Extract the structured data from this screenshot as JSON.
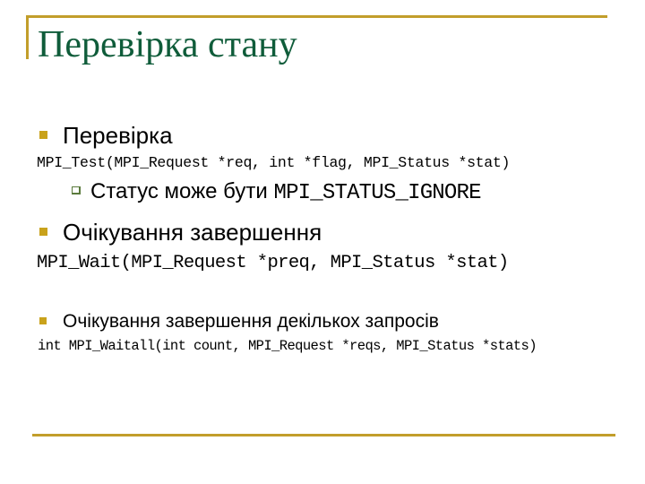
{
  "slide": {
    "title": "Перевірка стану",
    "accent_color": "#c29e2b",
    "title_color": "#0f5c3a",
    "items": [
      {
        "bullet": "filled-square",
        "text": "Перевірка",
        "code": "MPI_Test(MPI_Request *req, int *flag, MPI_Status *stat)",
        "subitems": [
          {
            "bullet": "hollow-square",
            "text": "Статус може бути ",
            "code_inline": "MPI_STATUS_IGNORE"
          }
        ]
      },
      {
        "bullet": "filled-square",
        "text": "Очікування завершення",
        "code": "MPI_Wait(MPI_Request *preq, MPI_Status *stat)"
      },
      {
        "bullet": "filled-square",
        "text": "Очікування завершення декількох запросів",
        "code": "int MPI_Waitall(int count, MPI_Request *reqs, MPI_Status *stats)"
      }
    ]
  }
}
